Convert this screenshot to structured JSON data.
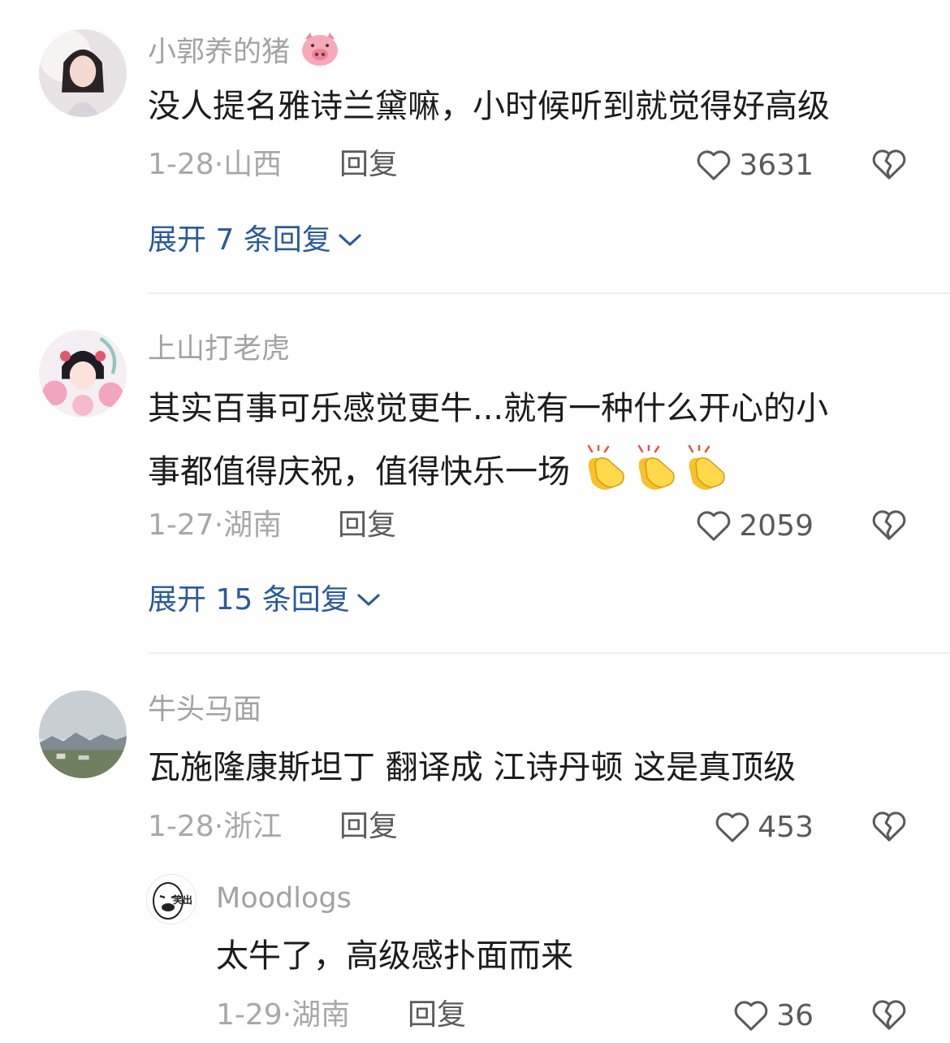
{
  "comments": [
    {
      "username": "小郭养的猪",
      "username_emoji": "pig-face-emoji",
      "text_lines": [
        "没人提名雅诗兰黛嘛，小时候听到就觉得好高级"
      ],
      "date": "1-28",
      "location": "山西",
      "reply_label": "回复",
      "likes": "3631",
      "expand_label": "展开 7 条回复"
    },
    {
      "username": "上山打老虎",
      "text_lines": [
        "其实百事可乐感觉更牛...就有一种什么开心的小",
        "事都值得庆祝，值得快乐一场"
      ],
      "text_emoji": [
        "clapping-hands-emoji",
        "clapping-hands-emoji",
        "clapping-hands-emoji"
      ],
      "date": "1-27",
      "location": "湖南",
      "reply_label": "回复",
      "likes": "2059",
      "expand_label": "展开 15 条回复"
    },
    {
      "username": "牛头马面",
      "text_lines": [
        "瓦施隆康斯坦丁 翻译成 江诗丹顿 这是真顶级"
      ],
      "date": "1-28",
      "location": "浙江",
      "reply_label": "回复",
      "likes": "453",
      "replies": [
        {
          "username": "Moodlogs",
          "avatar_text": "笑出",
          "text": "太牛了，高级感扑面而来",
          "date": "1-29",
          "location": "湖南",
          "reply_label": "回复",
          "likes": "36"
        }
      ]
    }
  ],
  "icons": {
    "like": "heart-outline-icon",
    "dislike": "broken-heart-outline-icon",
    "expand": "chevron-down-icon"
  },
  "colors": {
    "username": "#a3a3a3",
    "body_text": "#1c1c1c",
    "meta": "#a8a8a8",
    "expand_link": "#2b5a9a",
    "divider": "#f0f0f0"
  }
}
